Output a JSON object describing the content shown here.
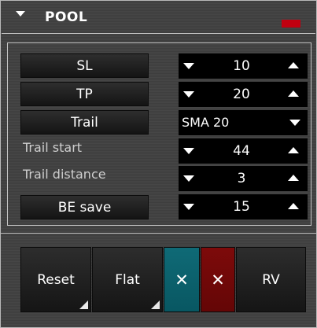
{
  "header": {
    "title": "POOL"
  },
  "controls": {
    "sl": {
      "label": "SL",
      "value": "10"
    },
    "tp": {
      "label": "TP",
      "value": "20"
    },
    "trail": {
      "label": "Trail",
      "selected": "SMA 20"
    },
    "trail_start": {
      "label": "Trail start",
      "value": "44"
    },
    "trail_distance": {
      "label": "Trail distance",
      "value": "3"
    },
    "be_save": {
      "label": "BE save",
      "value": "15"
    }
  },
  "actions": {
    "reset_label": "Reset",
    "flat_label": "Flat",
    "close_buy_label": "✕",
    "close_sell_label": "✕",
    "reverse_label": "RV"
  },
  "colors": {
    "status_led": "#c00010",
    "teal_button": "#0f6a76",
    "red_button": "#7d0a0a"
  },
  "icons": {
    "collapse": "caret-down-icon",
    "decrement": "triangle-down-icon",
    "increment": "triangle-up-icon"
  }
}
